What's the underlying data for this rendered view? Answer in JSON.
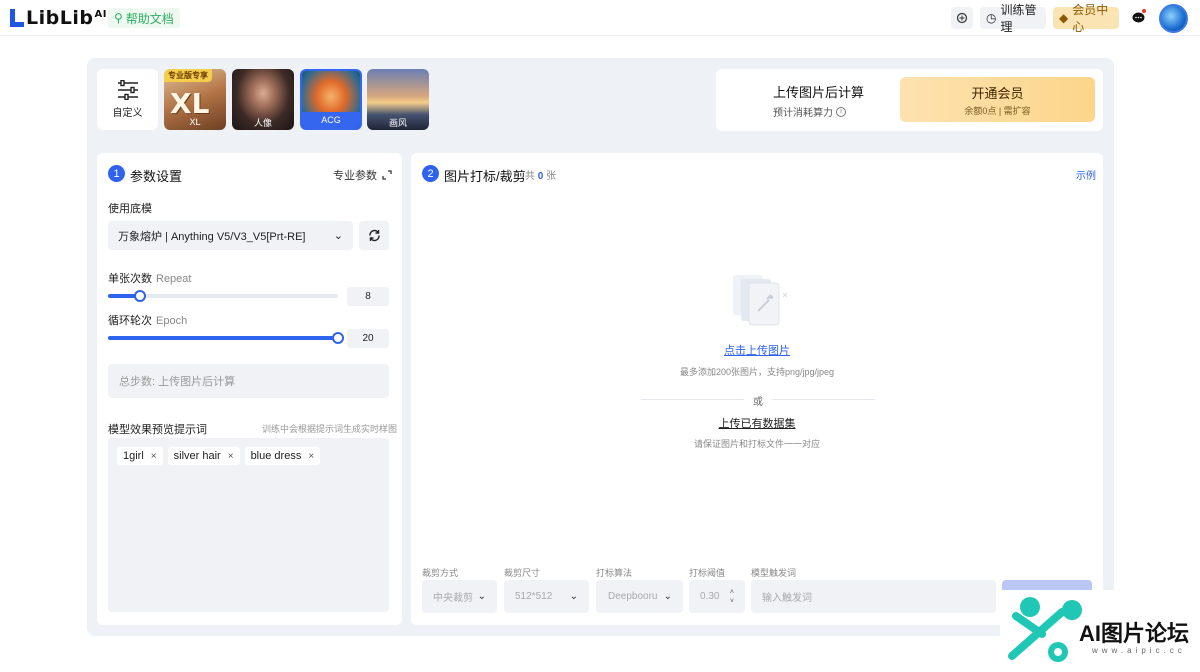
{
  "brand": {
    "name": "LibLib",
    "suffix": "AI"
  },
  "header": {
    "help_label": "帮助文档",
    "train_label": "训练管理",
    "vip_label": "会员中心"
  },
  "models": [
    {
      "label": "自定义",
      "badge": ""
    },
    {
      "label": "XL",
      "badge": "专业版专享",
      "art": "XL"
    },
    {
      "label": "人像"
    },
    {
      "label": "ACG",
      "selected": true
    },
    {
      "label": "画风"
    }
  ],
  "cost": {
    "title": "上传图片后计算",
    "subtitle": "预计消耗算力",
    "vip_button": "开通会员",
    "vip_sub": "余额0点 | 需扩容"
  },
  "params": {
    "step": "1",
    "title": "参数设置",
    "pro_label": "专业参数",
    "base_model_label": "使用底模",
    "base_model_value": "万象熔炉 | Anything V5/V3_V5[Prt-RE]",
    "repeat_label": "单张次数",
    "repeat_en": "Repeat",
    "repeat_value": "8",
    "repeat_level": 0.14,
    "epoch_label": "循环轮次",
    "epoch_en": "Epoch",
    "epoch_value": "20",
    "epoch_level": 1.0,
    "total_steps": "总步数: 上传图片后计算",
    "prompt_label": "模型效果预览提示词",
    "prompt_hint": "训练中会根据提示词生成实时样图",
    "tags": [
      "1girl",
      "silver hair",
      "blue dress"
    ]
  },
  "images": {
    "step": "2",
    "title": "图片打标/裁剪",
    "count_prefix": "共",
    "count": "0",
    "count_suffix": "张",
    "example": "示例",
    "upload_link": "点击上传图片",
    "upload_hint": "最多添加200张图片，支持png/jpg/jpeg",
    "or": "或",
    "dataset_link": "上传已有数据集",
    "dataset_hint": "请保证图片和打标文件一一对应"
  },
  "options": [
    {
      "label": "裁剪方式",
      "value": "中央裁剪"
    },
    {
      "label": "裁剪尺寸",
      "value": "512*512"
    },
    {
      "label": "打标算法",
      "value": "Deepbooru"
    },
    {
      "label": "打标阈值",
      "value": "0.30"
    },
    {
      "label": "模型触发词",
      "placeholder": "输入触发词"
    }
  ],
  "watermark": {
    "text": "AI图片论坛",
    "url": "www.aipic.cc"
  },
  "colors": {
    "accent": "#2f62ef",
    "vip": "#fcd58a",
    "help": "#2fae63"
  }
}
